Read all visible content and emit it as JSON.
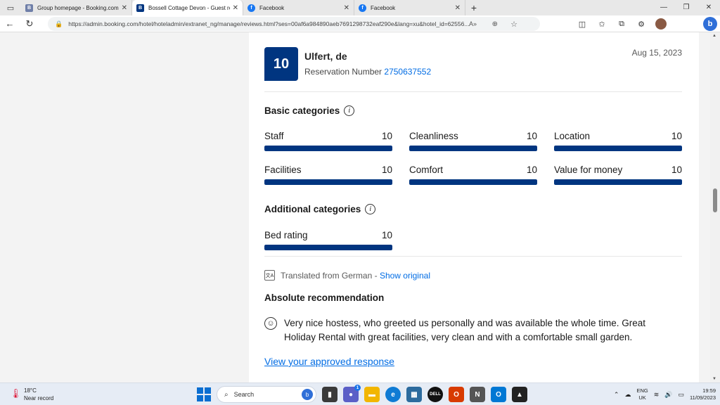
{
  "browser": {
    "tabs": [
      {
        "title": "Group homepage - Booking.com",
        "favicon": "B",
        "favicon_class": "bk",
        "active": false
      },
      {
        "title": "Bossell Cottage Devon - Guest re",
        "favicon": "B",
        "favicon_class": "bkd",
        "active": true
      },
      {
        "title": "Facebook",
        "favicon": "f",
        "favicon_class": "fb",
        "active": false
      },
      {
        "title": "Facebook",
        "favicon": "f",
        "favicon_class": "fb",
        "active": false
      }
    ],
    "url": "https://admin.booking.com/hotel/hoteladmin/extranet_ng/manage/reviews.html?ses=00af6a984890aeb7691298732eaf290e&lang=xu&hotel_id=62556..."
  },
  "review": {
    "score": "10",
    "guest_name": "Ulfert, de",
    "reservation_label": "Reservation Number",
    "reservation_number": "2750637552",
    "date": "Aug 15, 2023",
    "basic_heading": "Basic categories",
    "basic_categories": [
      {
        "label": "Staff",
        "value": "10",
        "fraction": 1.0
      },
      {
        "label": "Cleanliness",
        "value": "10",
        "fraction": 1.0
      },
      {
        "label": "Location",
        "value": "10",
        "fraction": 1.0
      },
      {
        "label": "Facilities",
        "value": "10",
        "fraction": 1.0
      },
      {
        "label": "Comfort",
        "value": "10",
        "fraction": 1.0
      },
      {
        "label": "Value for money",
        "value": "10",
        "fraction": 1.0
      }
    ],
    "additional_heading": "Additional categories",
    "additional_categories": [
      {
        "label": "Bed rating",
        "value": "10",
        "fraction": 1.0
      }
    ],
    "translated_text": "Translated from German",
    "show_original": "Show original",
    "review_title": "Absolute recommendation",
    "review_text": "Very nice hostess, who greeted us personally and was available the whole time. Great Holiday Rental with great facilities, very clean and with a comfortable small garden.",
    "response_link": "View your approved response"
  },
  "taskbar": {
    "temperature": "18°C",
    "weather_note": "Near record",
    "search_placeholder": "Search",
    "chat_badge": "1",
    "lang_top": "ENG",
    "lang_bottom": "UK",
    "time": "19:59",
    "date": "11/09/2023"
  },
  "colors": {
    "brand_blue": "#003580",
    "link_blue": "#006ce4"
  }
}
